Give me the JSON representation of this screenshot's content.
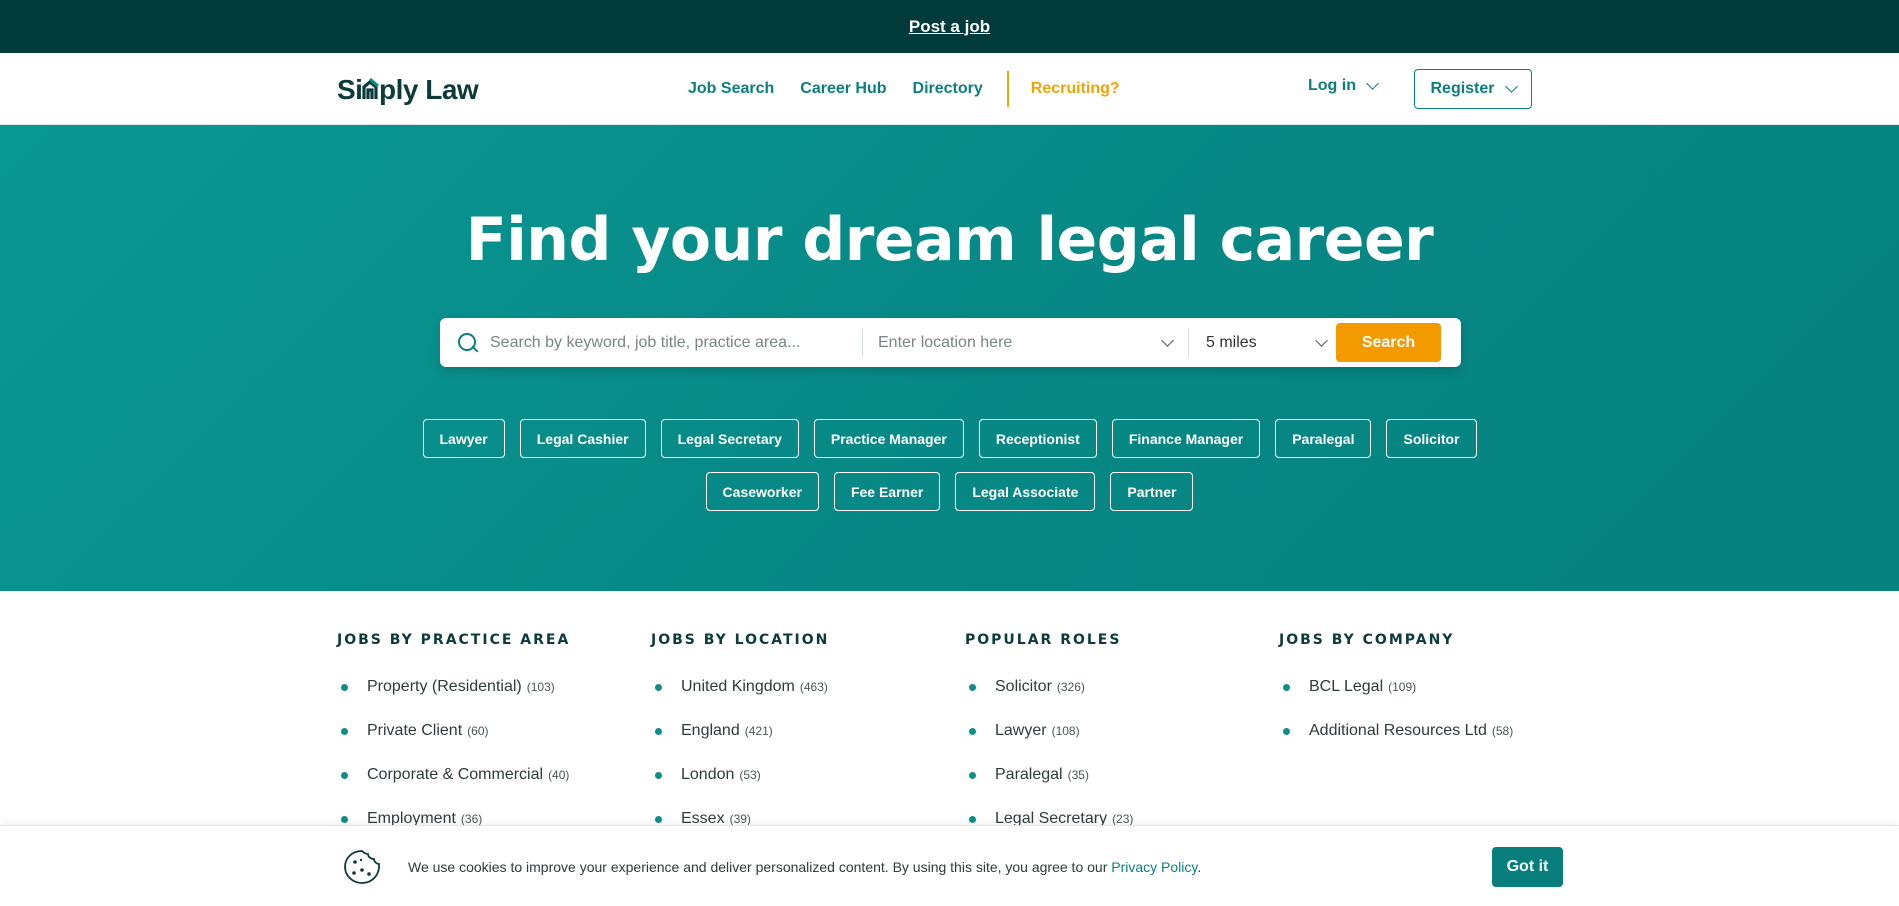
{
  "topbar": {
    "link": "Post a job"
  },
  "nav": {
    "logo": "Simply Law",
    "links": [
      "Job Search",
      "Career Hub",
      "Directory"
    ],
    "recruiting": "Recruiting?",
    "login": "Log in",
    "register": "Register"
  },
  "hero": {
    "title": "Find your dream legal career",
    "search_placeholder": "Search by keyword, job title, practice area...",
    "location_placeholder": "Enter location here",
    "radius": "5 miles",
    "search_button": "Search",
    "chips_row1": [
      "Lawyer",
      "Legal Cashier",
      "Legal Secretary",
      "Practice Manager",
      "Receptionist",
      "Finance Manager",
      "Paralegal",
      "Solicitor"
    ],
    "chips_row2": [
      "Caseworker",
      "Fee Earner",
      "Legal Associate",
      "Partner"
    ]
  },
  "columns": [
    {
      "title": "JOBS BY PRACTICE AREA",
      "items": [
        {
          "label": "Property (Residential)",
          "count": "(103)"
        },
        {
          "label": "Private Client",
          "count": "(60)"
        },
        {
          "label": "Corporate & Commercial",
          "count": "(40)"
        },
        {
          "label": "Employment",
          "count": "(36)"
        }
      ]
    },
    {
      "title": "JOBS BY LOCATION",
      "items": [
        {
          "label": "United Kingdom",
          "count": "(463)"
        },
        {
          "label": "England",
          "count": "(421)"
        },
        {
          "label": "London",
          "count": "(53)"
        },
        {
          "label": "Essex",
          "count": "(39)"
        }
      ]
    },
    {
      "title": "POPULAR ROLES",
      "items": [
        {
          "label": "Solicitor",
          "count": "(326)"
        },
        {
          "label": "Lawyer",
          "count": "(108)"
        },
        {
          "label": "Paralegal",
          "count": "(35)"
        },
        {
          "label": "Legal Secretary",
          "count": "(23)"
        }
      ]
    },
    {
      "title": "JOBS BY COMPANY",
      "items": [
        {
          "label": "BCL Legal",
          "count": "(109)"
        },
        {
          "label": "Additional Resources Ltd",
          "count": "(58)"
        }
      ]
    }
  ],
  "cookie": {
    "text": "We use cookies to improve your experience and deliver personalized content. By using this site, you agree to our ",
    "link": "Privacy Policy",
    "period": ".",
    "button": "Got it"
  },
  "colors": {
    "accent": "#0b7f80",
    "orange": "#f29a00",
    "dark": "#003a3a"
  }
}
